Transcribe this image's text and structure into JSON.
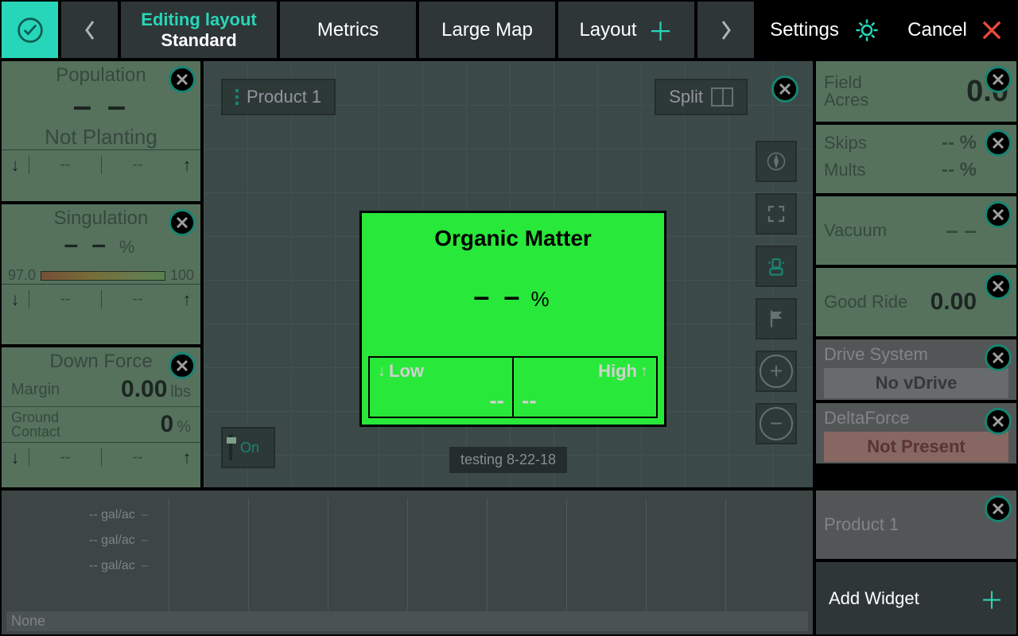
{
  "topbar": {
    "editing_label": "Editing layout",
    "layout_name": "Standard",
    "tabs": {
      "metrics": "Metrics",
      "large_map": "Large Map",
      "layout": "Layout"
    },
    "settings_label": "Settings",
    "cancel_label": "Cancel"
  },
  "left": {
    "population": {
      "title": "Population",
      "value": "– –",
      "status": "Not Planting",
      "low": "--",
      "high": "--"
    },
    "singulation": {
      "title": "Singulation",
      "value": "– –",
      "unit": "%",
      "gauge_min": "97.0",
      "gauge_max": "100",
      "low": "--",
      "high": "--"
    },
    "downforce": {
      "title": "Down Force",
      "margin_label": "Margin",
      "margin_value": "0.00",
      "margin_unit": "lbs",
      "ground_label_a": "Ground",
      "ground_label_b": "Contact",
      "ground_value": "0",
      "ground_unit": "%",
      "low": "--",
      "high": "--"
    }
  },
  "map": {
    "product_button": "Product 1",
    "split_button": "Split",
    "on_button": "On",
    "caption": "testing 8-22-18",
    "popup": {
      "title": "Organic Matter",
      "value": "– –",
      "unit": "%",
      "low_label": "Low",
      "high_label": "High",
      "low_value": "--",
      "high_value": "--"
    }
  },
  "right": {
    "field_acres": {
      "label_a": "Field",
      "label_b": "Acres",
      "value": "0.0"
    },
    "skips_mults": {
      "skips_label": "Skips",
      "skips_value": "-- %",
      "mults_label": "Mults",
      "mults_value": "-- %"
    },
    "vacuum": {
      "label": "Vacuum",
      "value": "– –"
    },
    "good_ride": {
      "label": "Good Ride",
      "value": "0.00"
    },
    "drive_system": {
      "label": "Drive System",
      "status": "No vDrive"
    },
    "delta_force": {
      "label": "DeltaForce",
      "status": "Not Present"
    },
    "product1": {
      "label": "Product 1"
    },
    "add_widget": "Add Widget"
  },
  "bottom": {
    "line1": "-- gal/ac",
    "line2": "-- gal/ac",
    "line3": "-- gal/ac",
    "none": "None"
  }
}
